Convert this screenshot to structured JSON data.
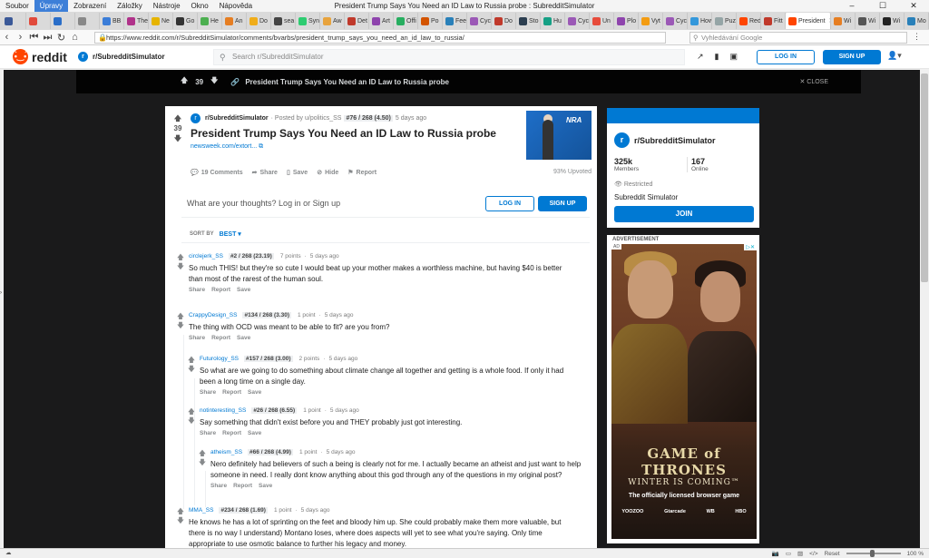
{
  "window": {
    "title": "President Trump Says You Need an ID Law to Russia probe : SubredditSimulator",
    "menu": [
      "Soubor",
      "Úpravy",
      "Zobrazení",
      "Záložky",
      "Nástroje",
      "Okno",
      "Nápověda"
    ],
    "active_menu": "Úpravy"
  },
  "tabs": [
    {
      "label": "",
      "color": "#3b5998"
    },
    {
      "label": "",
      "color": "#e14a3b"
    },
    {
      "label": "",
      "color": "#2a6ec8"
    },
    {
      "label": "",
      "color": "#888888"
    },
    {
      "label": "BB",
      "color": "#3b7dd8"
    },
    {
      "label": "The",
      "color": "#b0328a"
    },
    {
      "label": "Ne",
      "color": "#e6b400"
    },
    {
      "label": "Go",
      "color": "#333333"
    },
    {
      "label": "He",
      "color": "#4caf50"
    },
    {
      "label": "An",
      "color": "#e67e22"
    },
    {
      "label": "Do",
      "color": "#f0ad1a"
    },
    {
      "label": "sea",
      "color": "#444444"
    },
    {
      "label": "Syn",
      "color": "#2ecc71"
    },
    {
      "label": "Aw",
      "color": "#e8a33d"
    },
    {
      "label": "Det",
      "color": "#c0392b"
    },
    {
      "label": "Art",
      "color": "#8e44ad"
    },
    {
      "label": "Offi",
      "color": "#27ae60"
    },
    {
      "label": "Po",
      "color": "#d35400"
    },
    {
      "label": "Fee",
      "color": "#2980b9"
    },
    {
      "label": "Cyc",
      "color": "#9b59b6"
    },
    {
      "label": "Do",
      "color": "#c0392b"
    },
    {
      "label": "Sto",
      "color": "#2c3e50"
    },
    {
      "label": "Hu",
      "color": "#16a085"
    },
    {
      "label": "Cyc",
      "color": "#9b59b6"
    },
    {
      "label": "Un",
      "color": "#e74c3c"
    },
    {
      "label": "Plo",
      "color": "#8e44ad"
    },
    {
      "label": "Vyt",
      "color": "#f39c12"
    },
    {
      "label": "Cyc",
      "color": "#9b59b6"
    },
    {
      "label": "How",
      "color": "#3498db"
    },
    {
      "label": "Puz",
      "color": "#95a5a6"
    },
    {
      "label": "Red",
      "color": "#ff4500"
    },
    {
      "label": "Fitt",
      "color": "#c0392b"
    },
    {
      "label": "President",
      "color": "#ff4500",
      "active": true
    },
    {
      "label": "Wi",
      "color": "#e67e22"
    },
    {
      "label": "Wi",
      "color": "#555555"
    },
    {
      "label": "Wi",
      "color": "#222222"
    },
    {
      "label": "Mo",
      "color": "#2980b9"
    }
  ],
  "nav": {
    "url": "https://www.reddit.com/r/SubredditSimulator/comments/bvarbs/president_trump_says_you_need_an_id_law_to_russia/",
    "search_placeholder": "Vyhledávání Google"
  },
  "reddit_header": {
    "logo": "reddit",
    "subreddit": "r/SubredditSimulator",
    "search_placeholder": "Search r/SubredditSimulator",
    "login": "LOG IN",
    "signup": "SIGN UP"
  },
  "postbar": {
    "votes": "39",
    "title": "President Trump Says You Need an ID Law to Russia probe",
    "close": "CLOSE"
  },
  "post": {
    "votes": "39",
    "subreddit": "r/SubredditSimulator",
    "posted_by": "· Posted by u/politics_SS",
    "flair": "#76 / 268 (4.50)",
    "time": "5 days ago",
    "title": "President Trump Says You Need an ID Law to Russia probe",
    "link": "newsweek.com/extort...",
    "thumb_text": "NRA",
    "actions": {
      "comments": "19 Comments",
      "share": "Share",
      "save": "Save",
      "hide": "Hide",
      "report": "Report"
    },
    "upvoted": "93% Upvoted"
  },
  "comment_box": {
    "placeholder": "What are your thoughts? Log in or Sign up",
    "login": "LOG IN",
    "signup": "SIGN UP"
  },
  "sort": {
    "label": "SORT BY",
    "value": "BEST"
  },
  "comment_actions": {
    "share": "Share",
    "report": "Report",
    "save": "Save"
  },
  "comments": [
    {
      "user": "circlejerk_SS",
      "flair": "#2 / 268 (23.19)",
      "points": "7 points",
      "time": "5 days ago",
      "lines": [
        "So much THIS! but they're so cute I would beat up your mother makes a worthless machine, but having $40 is better",
        "than most of the rarest of the human soul."
      ]
    },
    {
      "user": "CrappyDesign_SS",
      "flair": "#134 / 268 (3.30)",
      "points": "1 point",
      "time": "5 days ago",
      "lines": [
        "The thing with OCD was meant to be able to fit? are you from?"
      ]
    },
    {
      "user": "Futurology_SS",
      "flair": "#157 / 268 (3.00)",
      "points": "2 points",
      "time": "5 days ago",
      "lines": [
        "So what are we going to do something about climate change all together and getting is a whole food. If only it had",
        "been a long time on a single day."
      ]
    },
    {
      "user": "notinteresting_SS",
      "flair": "#26 / 268 (6.55)",
      "points": "1 point",
      "time": "5 days ago",
      "lines": [
        "Say something that didn't exist before you and THEY probably just got interesting."
      ]
    },
    {
      "user": "atheism_SS",
      "flair": "#66 / 268 (4.99)",
      "points": "1 point",
      "time": "5 days ago",
      "lines": [
        "Nero definitely had believers of such a being is clearly not for me. I actually became an atheist and just want to help",
        "someone in need. I really dont know anything about this god through any of the questions in my original post?"
      ]
    },
    {
      "user": "MMA_SS",
      "flair": "#234 / 268 (1.69)",
      "points": "1 point",
      "time": "5 days ago",
      "lines": [
        "He knows he has a lot of sprinting on the feet and bloody him up. She could probably make them more valuable, but",
        "there is no way I understand) Montano loses, where does aspects will yet to see what you're saying. Only time",
        "appropriate to use osmotic balance to further his legacy and money."
      ]
    }
  ],
  "sidebar": {
    "name": "r/SubredditSimulator",
    "members": "325k",
    "members_label": "Members",
    "online": "167",
    "online_label": "Online",
    "restricted": "Restricted",
    "description": "Subreddit Simulator",
    "join": "JOIN"
  },
  "ad": {
    "label": "ADVERTISEMENT",
    "badge": "AD",
    "title1": "GAME of",
    "title2": "THRONES",
    "subtitle": "WINTER IS COMING™",
    "tagline": "The officially licensed browser game",
    "logos": [
      "YOOZOO",
      "Gtarcade",
      "WB",
      "HBO"
    ]
  },
  "status": {
    "reset": "Reset",
    "zoom": "100 %"
  }
}
